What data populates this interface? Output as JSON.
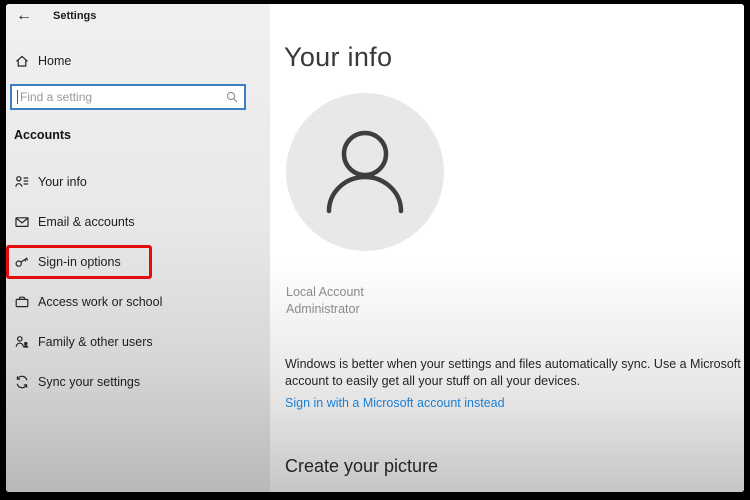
{
  "window": {
    "title": "Settings",
    "back_glyph": "←"
  },
  "sidebar": {
    "home": {
      "label": "Home"
    },
    "search": {
      "placeholder": "Find a setting"
    },
    "section_heading": "Accounts",
    "items": [
      {
        "label": "Your info",
        "icon": "your-info-icon",
        "highlighted": false
      },
      {
        "label": "Email & accounts",
        "icon": "email-icon",
        "highlighted": false
      },
      {
        "label": "Sign-in options",
        "icon": "key-icon",
        "highlighted": true
      },
      {
        "label": "Access work or school",
        "icon": "briefcase-icon",
        "highlighted": false
      },
      {
        "label": "Family & other users",
        "icon": "family-icon",
        "highlighted": false
      },
      {
        "label": "Sync your settings",
        "icon": "sync-icon",
        "highlighted": false
      }
    ],
    "highlight_color": "#e40d0d"
  },
  "main": {
    "title": "Your info",
    "account_name": "Local Account",
    "account_role": "Administrator",
    "sync_text": "Windows is better when your settings and files automatically sync. Use a Microsoft account to easily get all your stuff on all your devices.",
    "link_label": "Sign in with a Microsoft account instead",
    "link_color": "#1b7fd4",
    "section_heading": "Create your picture"
  }
}
